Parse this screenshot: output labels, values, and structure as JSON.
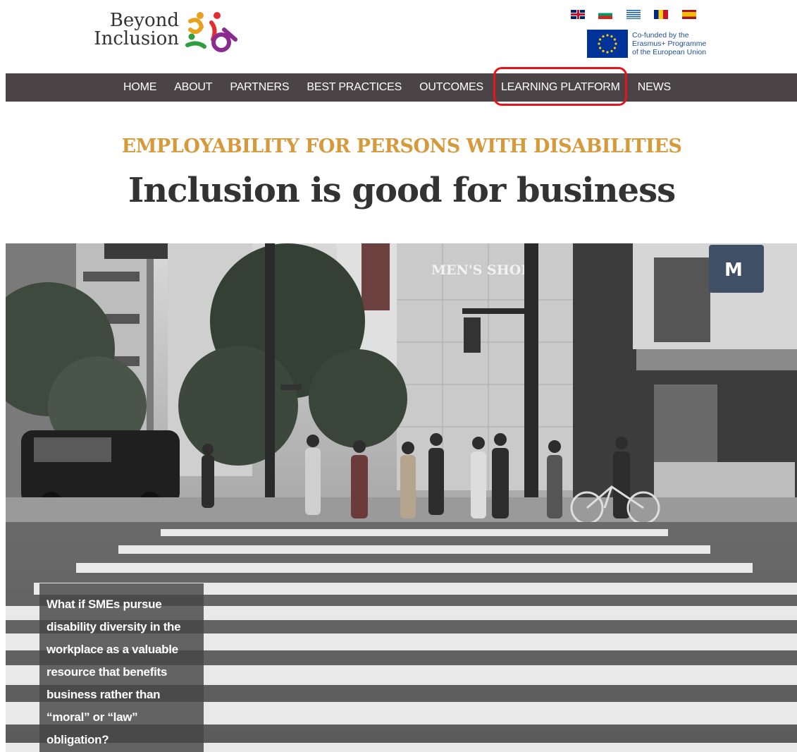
{
  "logo": {
    "line1": "Beyond",
    "line2": "Inclusion"
  },
  "languages": [
    {
      "code": "en",
      "icon": "uk-flag-icon"
    },
    {
      "code": "bg",
      "icon": "bulgaria-flag-icon"
    },
    {
      "code": "el",
      "icon": "greece-flag-icon"
    },
    {
      "code": "ro",
      "icon": "romania-flag-icon"
    },
    {
      "code": "es",
      "icon": "spain-flag-icon"
    }
  ],
  "eu_badge": {
    "line1": "Co-funded by the",
    "line2": "Erasmus+ Programme",
    "line3": "of the European Union",
    "icon": "eu-flag-icon"
  },
  "nav": {
    "items": [
      "HOME",
      "ABOUT",
      "PARTNERS",
      "BEST PRACTICES",
      "OUTCOMES",
      "LEARNING PLATFORM",
      "NEWS"
    ],
    "highlighted": "LEARNING PLATFORM",
    "highlight_color": "#e8141b"
  },
  "hero": {
    "eyebrow": "EMPLOYABILITY FOR PERSONS WITH DISABILITIES",
    "headline": "Inclusion is good for business",
    "caption": "What if SMEs pursue disability diversity in the workplace as a valuable resource that benefits business rather than “moral” or “law” obligation?",
    "sign_text": "MEN'S SHOP"
  },
  "colors": {
    "nav_bg": "#4a4446",
    "eyebrow": "#d49a3c",
    "headline": "#333333"
  }
}
